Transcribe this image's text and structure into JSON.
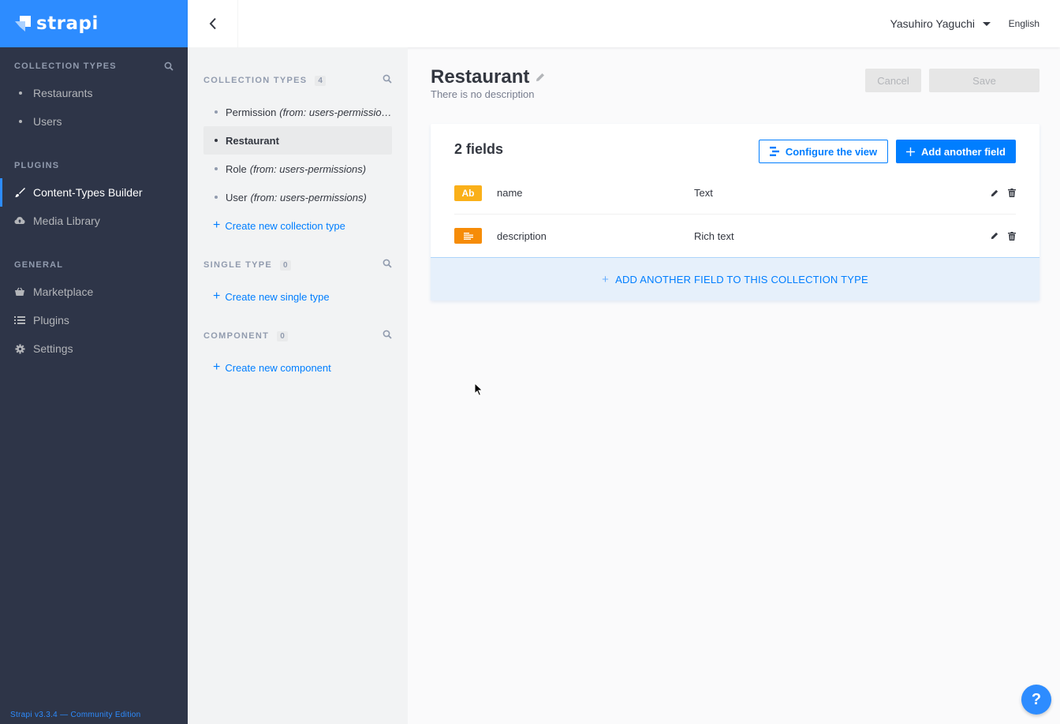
{
  "brand": {
    "name": "strapi"
  },
  "leftnav": {
    "collection_heading": "COLLECTION TYPES",
    "collection_items": [
      "Restaurants",
      "Users"
    ],
    "plugins_heading": "PLUGINS",
    "plugin_items": [
      {
        "label": "Content-Types Builder",
        "icon": "brush-icon",
        "active": true
      },
      {
        "label": "Media Library",
        "icon": "cloud-icon",
        "active": false
      }
    ],
    "general_heading": "GENERAL",
    "general_items": [
      {
        "label": "Marketplace",
        "icon": "basket-icon"
      },
      {
        "label": "Plugins",
        "icon": "list-icon"
      },
      {
        "label": "Settings",
        "icon": "gear-icon"
      }
    ],
    "footer": "Strapi v3.3.4 — Community Edition"
  },
  "topbar": {
    "user": "Yasuhiro Yaguchi",
    "language": "English"
  },
  "subnav": {
    "collection_heading": "COLLECTION TYPES",
    "collection_count": "4",
    "collection_items": [
      {
        "name": "Permission",
        "from": "(from: users-permissio…"
      },
      {
        "name": "Restaurant",
        "from": ""
      },
      {
        "name": "Role",
        "from": "(from: users-permissions)"
      },
      {
        "name": "User",
        "from": "(from: users-permissions)"
      }
    ],
    "create_collection": "Create new collection type",
    "single_heading": "SINGLE TYPE",
    "single_count": "0",
    "create_single": "Create new single type",
    "component_heading": "COMPONENT",
    "component_count": "0",
    "create_component": "Create new component"
  },
  "main": {
    "title": "Restaurant",
    "description": "There is no description",
    "cancel_label": "Cancel",
    "save_label": "Save",
    "fields_count": "2 fields",
    "configure_label": "Configure the view",
    "add_field_label": "Add another field",
    "fields": [
      {
        "icon_text": "Ab",
        "name": "name",
        "type": "Text"
      },
      {
        "icon_text": "",
        "name": "description",
        "type": "Rich text"
      }
    ],
    "add_field_bar": "ADD ANOTHER FIELD TO THIS COLLECTION TYPE"
  },
  "help": {
    "label": "?"
  },
  "colors": {
    "primary": "#007eff",
    "brand": "#2d8cff",
    "nav_bg": "#2e3548",
    "text_icon": "#fab019",
    "rich_icon": "#f68c08"
  }
}
